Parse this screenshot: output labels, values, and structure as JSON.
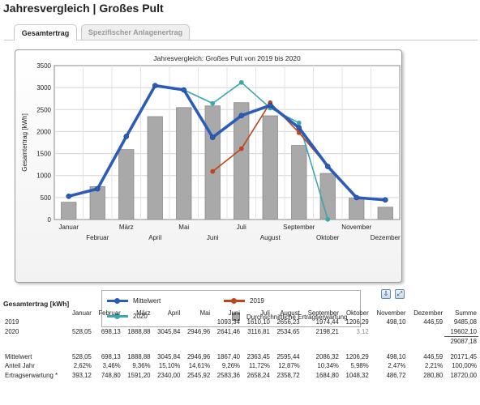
{
  "page": {
    "title": "Jahresvergleich | Großes Pult"
  },
  "tabs": [
    {
      "label": "Gesamtertrag",
      "active": true
    },
    {
      "label": "Spezifischer Anlagenertrag",
      "active": false
    }
  ],
  "chart_data": {
    "type": "bar",
    "title": "Jahresvergleich: Großes Pult von 2019 bis 2020",
    "ylabel": "Gesamtertrag [kWh]",
    "xlabel": "",
    "ylim": [
      0,
      3500
    ],
    "yticks": [
      0,
      500,
      1000,
      1500,
      2000,
      2500,
      3000,
      3500
    ],
    "categories": [
      "Januar",
      "Februar",
      "März",
      "April",
      "Mai",
      "Juni",
      "Juli",
      "August",
      "September",
      "Oktober",
      "November",
      "Dezember"
    ],
    "grid": true,
    "series": [
      {
        "name": "Durchschnittliche Ertragserwartung",
        "kind": "bar",
        "color": "#a9a9a9",
        "values": [
          393.12,
          748.8,
          1591.2,
          2340.0,
          2545.92,
          2583.36,
          2658.24,
          2358.72,
          1684.8,
          1048.32,
          486.72,
          280.8
        ]
      },
      {
        "name": "Mittelwert",
        "kind": "line",
        "color": "#2a5cb8",
        "values": [
          528.05,
          698.13,
          1888.88,
          3045.84,
          2946.96,
          1867.4,
          2363.45,
          2595.44,
          2086.32,
          1206.29,
          498.1,
          446.59
        ]
      },
      {
        "name": "2019",
        "kind": "line",
        "color": "#c0441a",
        "values": [
          null,
          null,
          null,
          null,
          null,
          1093.34,
          1610.1,
          2656.23,
          1974.44,
          1206.29,
          498.1,
          446.59
        ]
      },
      {
        "name": "2020",
        "kind": "line",
        "color": "#3aa6b0",
        "values": [
          528.05,
          698.13,
          1888.88,
          3045.84,
          2946.96,
          2641.46,
          3116.81,
          2534.65,
          2198.21,
          3.12,
          null,
          null
        ]
      }
    ]
  },
  "legend": {
    "mittelwert": "Mittelwert",
    "y2019": "2019",
    "y2020": "2020",
    "erwartung": "Durchschnittliche Ertragserwartung"
  },
  "toolbar": {
    "export_icon": "export-icon",
    "fullscreen_icon": "expand-icon"
  },
  "table": {
    "title": "Gesamtertrag [kWh]",
    "headers": [
      "",
      "Januar",
      "Februar",
      "März",
      "April",
      "Mai",
      "Juni",
      "Juli",
      "August",
      "September",
      "Oktober",
      "November",
      "Dezember",
      "Summe"
    ],
    "rows": [
      {
        "label": "2019",
        "cells": [
          "",
          "",
          "",
          "",
          "",
          "1093,34",
          "1610,10",
          "2656,23",
          "1974,44",
          "1206,29",
          "498,10",
          "446,59",
          "9485,08"
        ]
      },
      {
        "label": "2020",
        "cells": [
          "528,05",
          "698,13",
          "1888,88",
          "3045,84",
          "2946,96",
          "2641,46",
          "3116,81",
          "2534,65",
          "2198,21",
          "3,12",
          "",
          "",
          "19602,10"
        ]
      },
      {
        "label": "",
        "cells": [
          "",
          "",
          "",
          "",
          "",
          "",
          "",
          "",
          "",
          "",
          "",
          "",
          "29087,18"
        ]
      },
      {
        "label": "Mittelwert",
        "cells": [
          "528,05",
          "698,13",
          "1888,88",
          "3045,84",
          "2946,96",
          "1867,40",
          "2363,45",
          "2595,44",
          "2086,32",
          "1206,29",
          "498,10",
          "446,59",
          "20171,45"
        ]
      },
      {
        "label": "Anteil Jahr",
        "cells": [
          "2,62%",
          "3,46%",
          "9,36%",
          "15,10%",
          "14,61%",
          "9,26%",
          "11,72%",
          "12,87%",
          "10,34%",
          "5,98%",
          "2,47%",
          "2,21%",
          "100,00%"
        ]
      },
      {
        "label": "Ertragserwartung *",
        "cells": [
          "393,12",
          "748,80",
          "1591,20",
          "2340,00",
          "2545,92",
          "2583,36",
          "2658,24",
          "2358,72",
          "1684,80",
          "1048,32",
          "486,72",
          "280,80",
          "18720,00"
        ]
      }
    ]
  }
}
